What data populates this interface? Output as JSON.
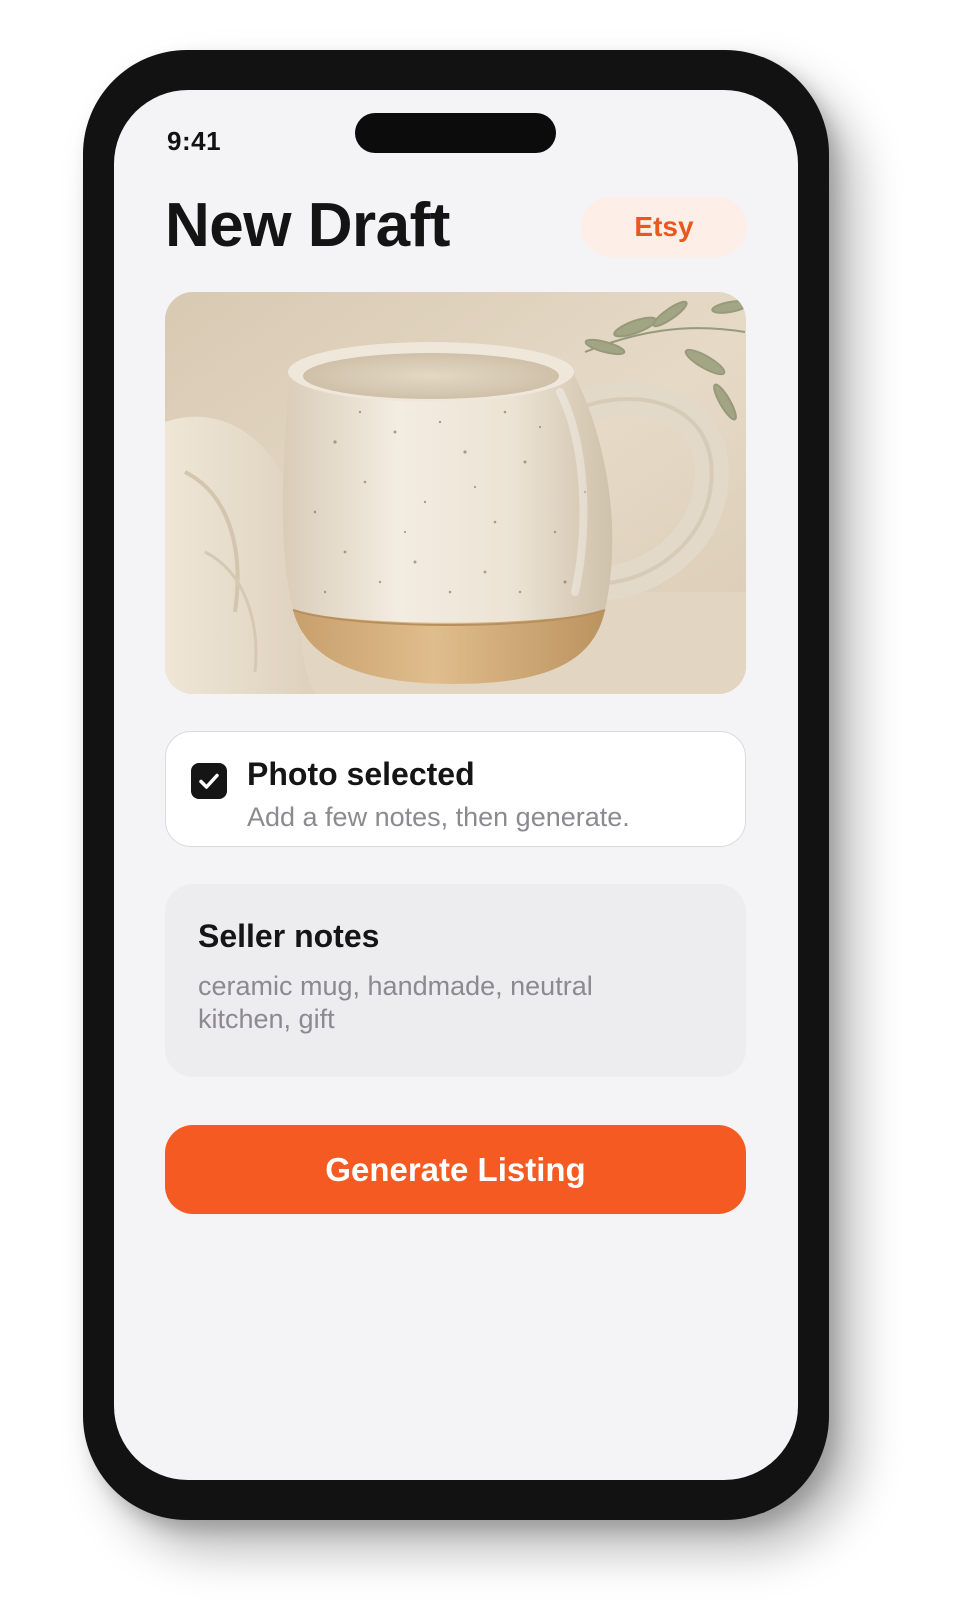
{
  "status_bar": {
    "time": "9:41"
  },
  "header": {
    "title": "New Draft",
    "platform_badge": "Etsy"
  },
  "photo": {
    "subject": "ceramic mug"
  },
  "photo_status": {
    "title": "Photo selected",
    "subtitle": "Add a few notes, then generate.",
    "checked": true
  },
  "seller_notes": {
    "label": "Seller notes",
    "value": "ceramic mug, handmade, neutral kitchen, gift"
  },
  "actions": {
    "generate_label": "Generate Listing"
  },
  "colors": {
    "accent": "#f45a21",
    "badge_bg": "#fdeee8",
    "badge_text": "#e9581f",
    "screen_bg": "#f4f3f5",
    "device_frame": "#121212"
  },
  "icons": {
    "check": "checkmark-icon"
  }
}
